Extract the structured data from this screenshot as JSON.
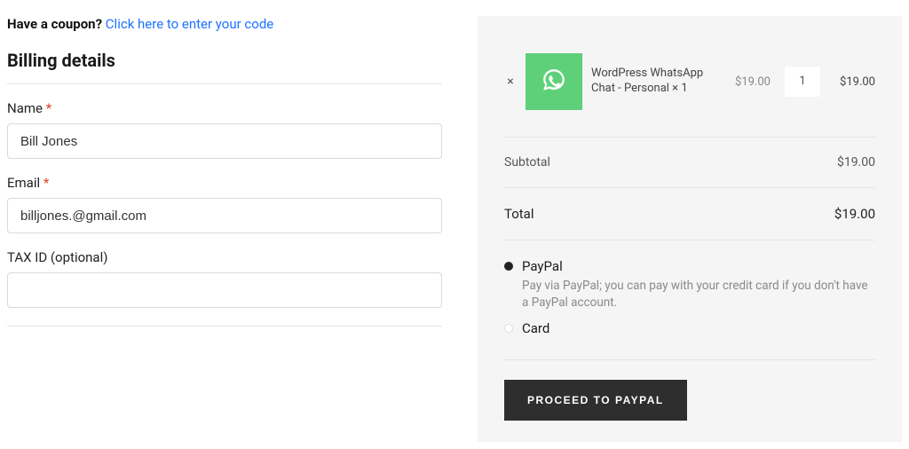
{
  "coupon": {
    "question": "Have a coupon?",
    "link_text": "Click here to enter your code"
  },
  "billing": {
    "heading": "Billing details",
    "fields": {
      "name": {
        "label": "Name",
        "required": "*",
        "value": "Bill Jones"
      },
      "email": {
        "label": "Email",
        "required": "*",
        "value": "billjones.@gmail.com"
      },
      "taxid": {
        "label": "TAX ID (optional)",
        "value": ""
      }
    }
  },
  "order": {
    "item": {
      "remove_glyph": "×",
      "name": "WordPress WhatsApp Chat - Personal × 1",
      "unit_price": "$19.00",
      "qty": "1",
      "line_total": "$19.00"
    },
    "subtotal": {
      "label": "Subtotal",
      "amount": "$19.00"
    },
    "total": {
      "label": "Total",
      "amount": "$19.00"
    }
  },
  "payment": {
    "paypal": {
      "label": "PayPal",
      "description": "Pay via PayPal; you can pay with your credit card if you don't have a PayPal account."
    },
    "card": {
      "label": "Card"
    }
  },
  "submit": {
    "label": "PROCEED TO PAYPAL"
  }
}
